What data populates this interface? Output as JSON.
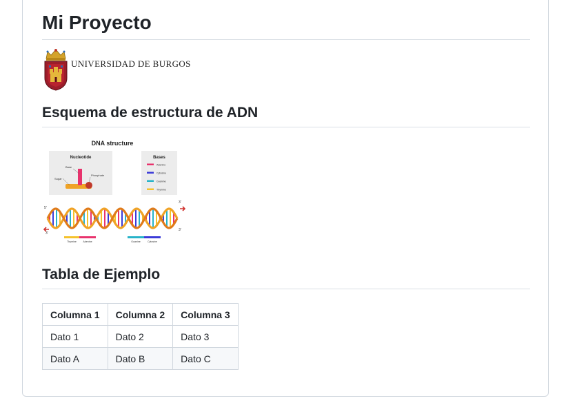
{
  "page": {
    "title": "Mi Proyecto"
  },
  "logo": {
    "text": "UNIVERSIDAD DE BURGOS"
  },
  "section_dna": {
    "heading": "Esquema de estructura de ADN",
    "figure": {
      "title": "DNA structure",
      "nucleotide_label": "Nucleotide",
      "base_label": "Base",
      "sugar_label": "Sugar",
      "phosphate_label": "Phosphate",
      "bases_label": "Bases",
      "bases": [
        {
          "name": "Adenine",
          "color": "#e8336d"
        },
        {
          "name": "Cytosine",
          "color": "#3b3bd8"
        },
        {
          "name": "Guanine",
          "color": "#27b3c9"
        },
        {
          "name": "Thymine",
          "color": "#f5c22b"
        }
      ],
      "strand_left_top": "5'",
      "strand_left_bottom": "3'",
      "strand_right_top": "3'",
      "strand_right_bottom": "3'",
      "pair1_left": "Thymine",
      "pair1_right": "Adenine",
      "pair2_left": "Guanine",
      "pair2_right": "Cytosine"
    }
  },
  "section_table": {
    "heading": "Tabla de Ejemplo",
    "headers": [
      "Columna 1",
      "Columna 2",
      "Columna 3"
    ],
    "rows": [
      [
        "Dato 1",
        "Dato 2",
        "Dato 3"
      ],
      [
        "Dato A",
        "Dato B",
        "Dato C"
      ]
    ]
  }
}
